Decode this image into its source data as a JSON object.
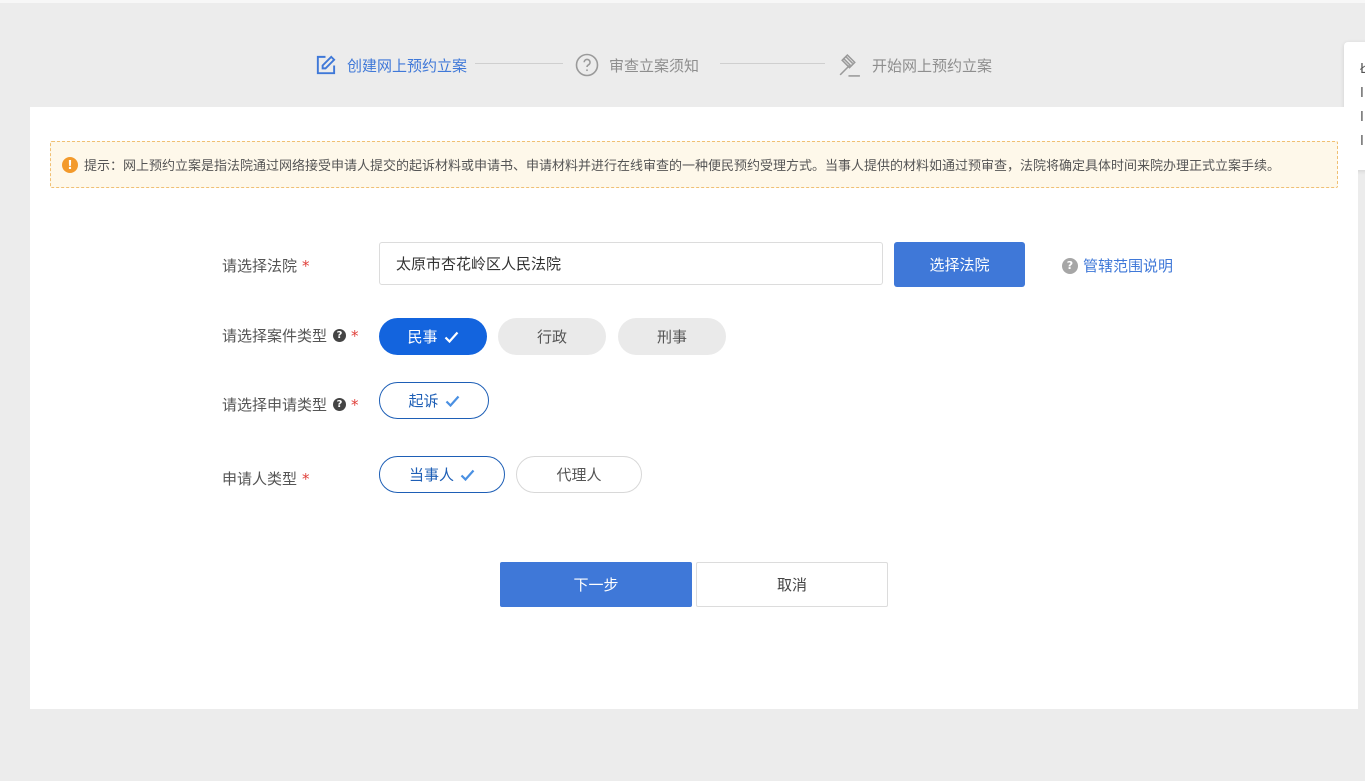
{
  "steps": [
    {
      "label": "创建网上预约立案",
      "icon": "edit-icon"
    },
    {
      "label": "审查立案须知",
      "icon": "question-circle-icon"
    },
    {
      "label": "开始网上预约立案",
      "icon": "gavel-icon"
    }
  ],
  "side_panel": {
    "chars": [
      "Ł",
      "Ⅰ",
      "Ⅰ",
      "Ⅰ"
    ]
  },
  "notice": {
    "icon": "!",
    "text": "提示：网上预约立案是指法院通过网络接受申请人提交的起诉材料或申请书、申请材料并进行在线审查的一种便民预约受理方式。当事人提供的材料如通过预审查，法院将确定具体时间来院办理正式立案手续。"
  },
  "court": {
    "label": "请选择法院",
    "required": "*",
    "value": "太原市杏花岭区人民法院",
    "select_button": "选择法院",
    "scope_help_icon": "?",
    "scope_link": "管辖范围说明"
  },
  "case_type": {
    "label": "请选择案件类型",
    "help_icon": "?",
    "required": "*",
    "options": [
      "民事",
      "行政",
      "刑事"
    ],
    "selected": "民事"
  },
  "apply_type": {
    "label": "请选择申请类型",
    "help_icon": "?",
    "required": "*",
    "options": [
      "起诉"
    ],
    "selected": "起诉"
  },
  "applicant_type": {
    "label": "申请人类型",
    "required": "*",
    "options": [
      "当事人",
      "代理人"
    ],
    "selected": "当事人"
  },
  "actions": {
    "next": "下一步",
    "cancel": "取消"
  },
  "colors": {
    "accent": "#3f78d8",
    "selected_pill": "#1364de",
    "required": "#e0403a",
    "notice_bg": "#fef8ea"
  }
}
